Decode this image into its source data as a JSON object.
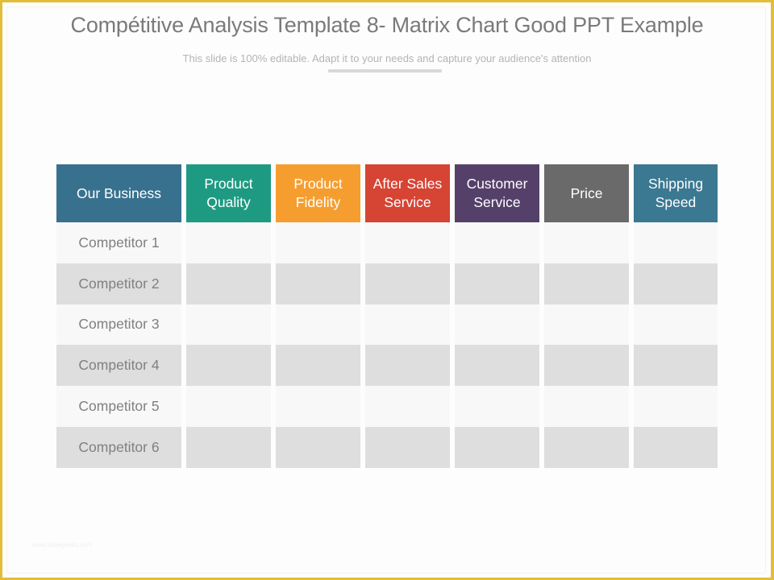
{
  "slide": {
    "title": "Compétitive Analysis Template 8- Matrix Chart Good PPT Example",
    "subtitle": "This slide is 100% editable.  Adapt it to your needs and capture your audience's attention",
    "footer_watermark": "www.slidegeeks.com"
  },
  "colors": {
    "frame_border": "#e3bd37",
    "row_light": "#f8f8f8",
    "row_dark": "#dedede",
    "label_text": "#808080"
  },
  "matrix": {
    "headers": [
      {
        "label": "Our Business",
        "color": "#38718e"
      },
      {
        "label": "Product\nQuality",
        "color": "#1f9a82"
      },
      {
        "label": "Product\nFidelity",
        "color": "#f59e2f"
      },
      {
        "label": "After Sales\nService",
        "color": "#d64434"
      },
      {
        "label": "Customer\nService",
        "color": "#55406a"
      },
      {
        "label": "Price",
        "color": "#6a6a6a"
      },
      {
        "label": "Shipping\nSpeed",
        "color": "#3b7891"
      }
    ],
    "rows": [
      {
        "label": "Competitor 1",
        "cells": [
          "",
          "",
          "",
          "",
          "",
          ""
        ]
      },
      {
        "label": "Competitor 2",
        "cells": [
          "",
          "",
          "",
          "",
          "",
          ""
        ]
      },
      {
        "label": "Competitor 3",
        "cells": [
          "",
          "",
          "",
          "",
          "",
          ""
        ]
      },
      {
        "label": "Competitor 4",
        "cells": [
          "",
          "",
          "",
          "",
          "",
          ""
        ]
      },
      {
        "label": "Competitor 5",
        "cells": [
          "",
          "",
          "",
          "",
          "",
          ""
        ]
      },
      {
        "label": "Competitor 6",
        "cells": [
          "",
          "",
          "",
          "",
          "",
          ""
        ]
      }
    ]
  }
}
